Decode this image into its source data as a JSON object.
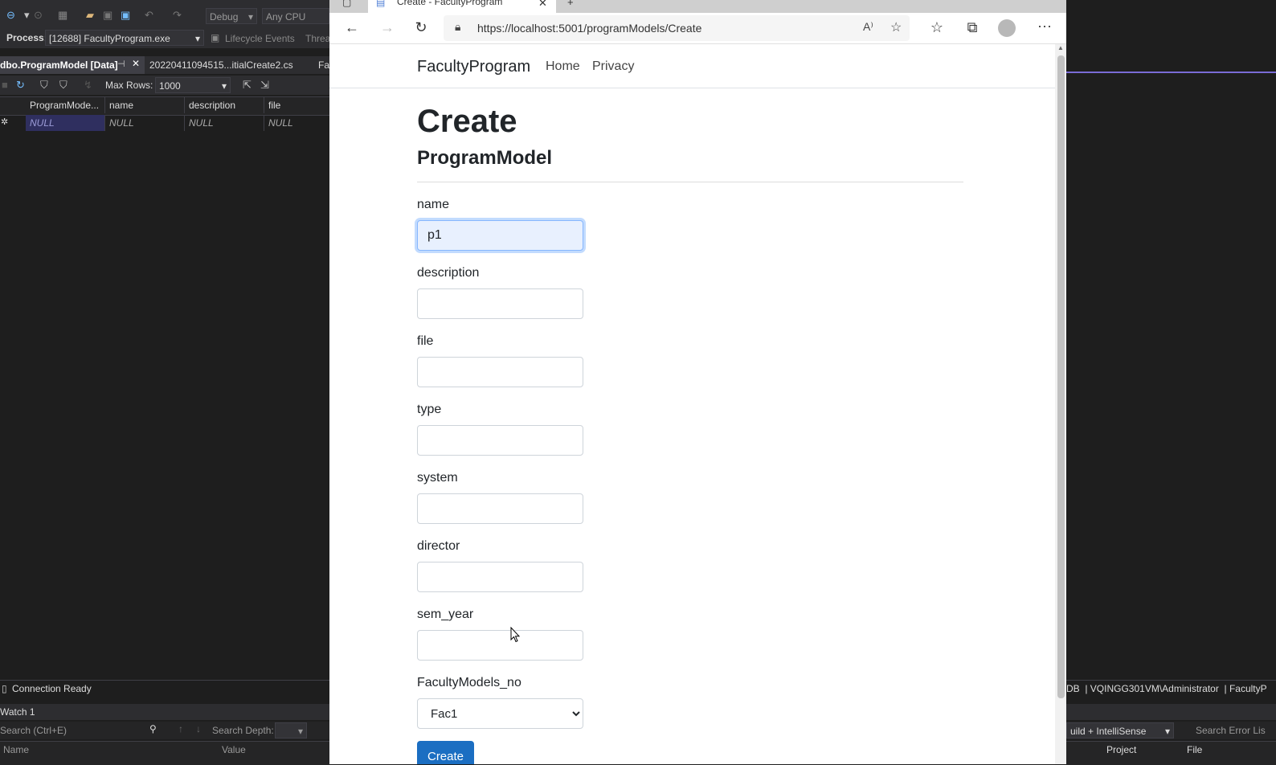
{
  "vs": {
    "config": "Debug",
    "platform": "Any CPU",
    "process_label": "Process:",
    "process_value": "[12688] FacultyProgram.exe",
    "lifecycle_label": "Lifecycle Events",
    "thread_label": "Threa",
    "tabs": [
      {
        "label": "dbo.ProgramModel [Data]"
      },
      {
        "label": "20220411094515...itialCreate2.cs"
      },
      {
        "label": "Fa"
      }
    ],
    "max_rows_label": "Max Rows:",
    "max_rows_value": "1000",
    "grid": {
      "columns": [
        "ProgramMode...",
        "name",
        "description",
        "file"
      ],
      "row": [
        "NULL",
        "NULL",
        "NULL",
        "NULL"
      ]
    },
    "status": "Connection Ready",
    "watch_title": "Watch 1",
    "watch_search_placeholder": "Search (Ctrl+E)",
    "search_depth_label": "Search Depth:",
    "watch_columns": [
      "Name",
      "Value"
    ],
    "right_status": "DB  | VQINGG301VM\\Administrator  | FacultyP",
    "build_filter": "uild + IntelliSense",
    "error_search": "Search Error Lis",
    "error_columns": [
      "Project",
      "File"
    ]
  },
  "browser": {
    "tab_title": "Create - FacultyProgram",
    "url": "https://localhost:5001/programModels/Create"
  },
  "site": {
    "brand": "FacultyProgram",
    "nav": [
      "Home",
      "Privacy"
    ],
    "title": "Create",
    "subtitle": "ProgramModel",
    "fields": [
      {
        "label": "name",
        "value": "p1"
      },
      {
        "label": "description",
        "value": ""
      },
      {
        "label": "file",
        "value": ""
      },
      {
        "label": "type",
        "value": ""
      },
      {
        "label": "system",
        "value": ""
      },
      {
        "label": "director",
        "value": ""
      },
      {
        "label": "sem_year",
        "value": ""
      }
    ],
    "select": {
      "label": "FacultyModels_no",
      "value": "Fac1"
    },
    "submit_label": "Create"
  }
}
